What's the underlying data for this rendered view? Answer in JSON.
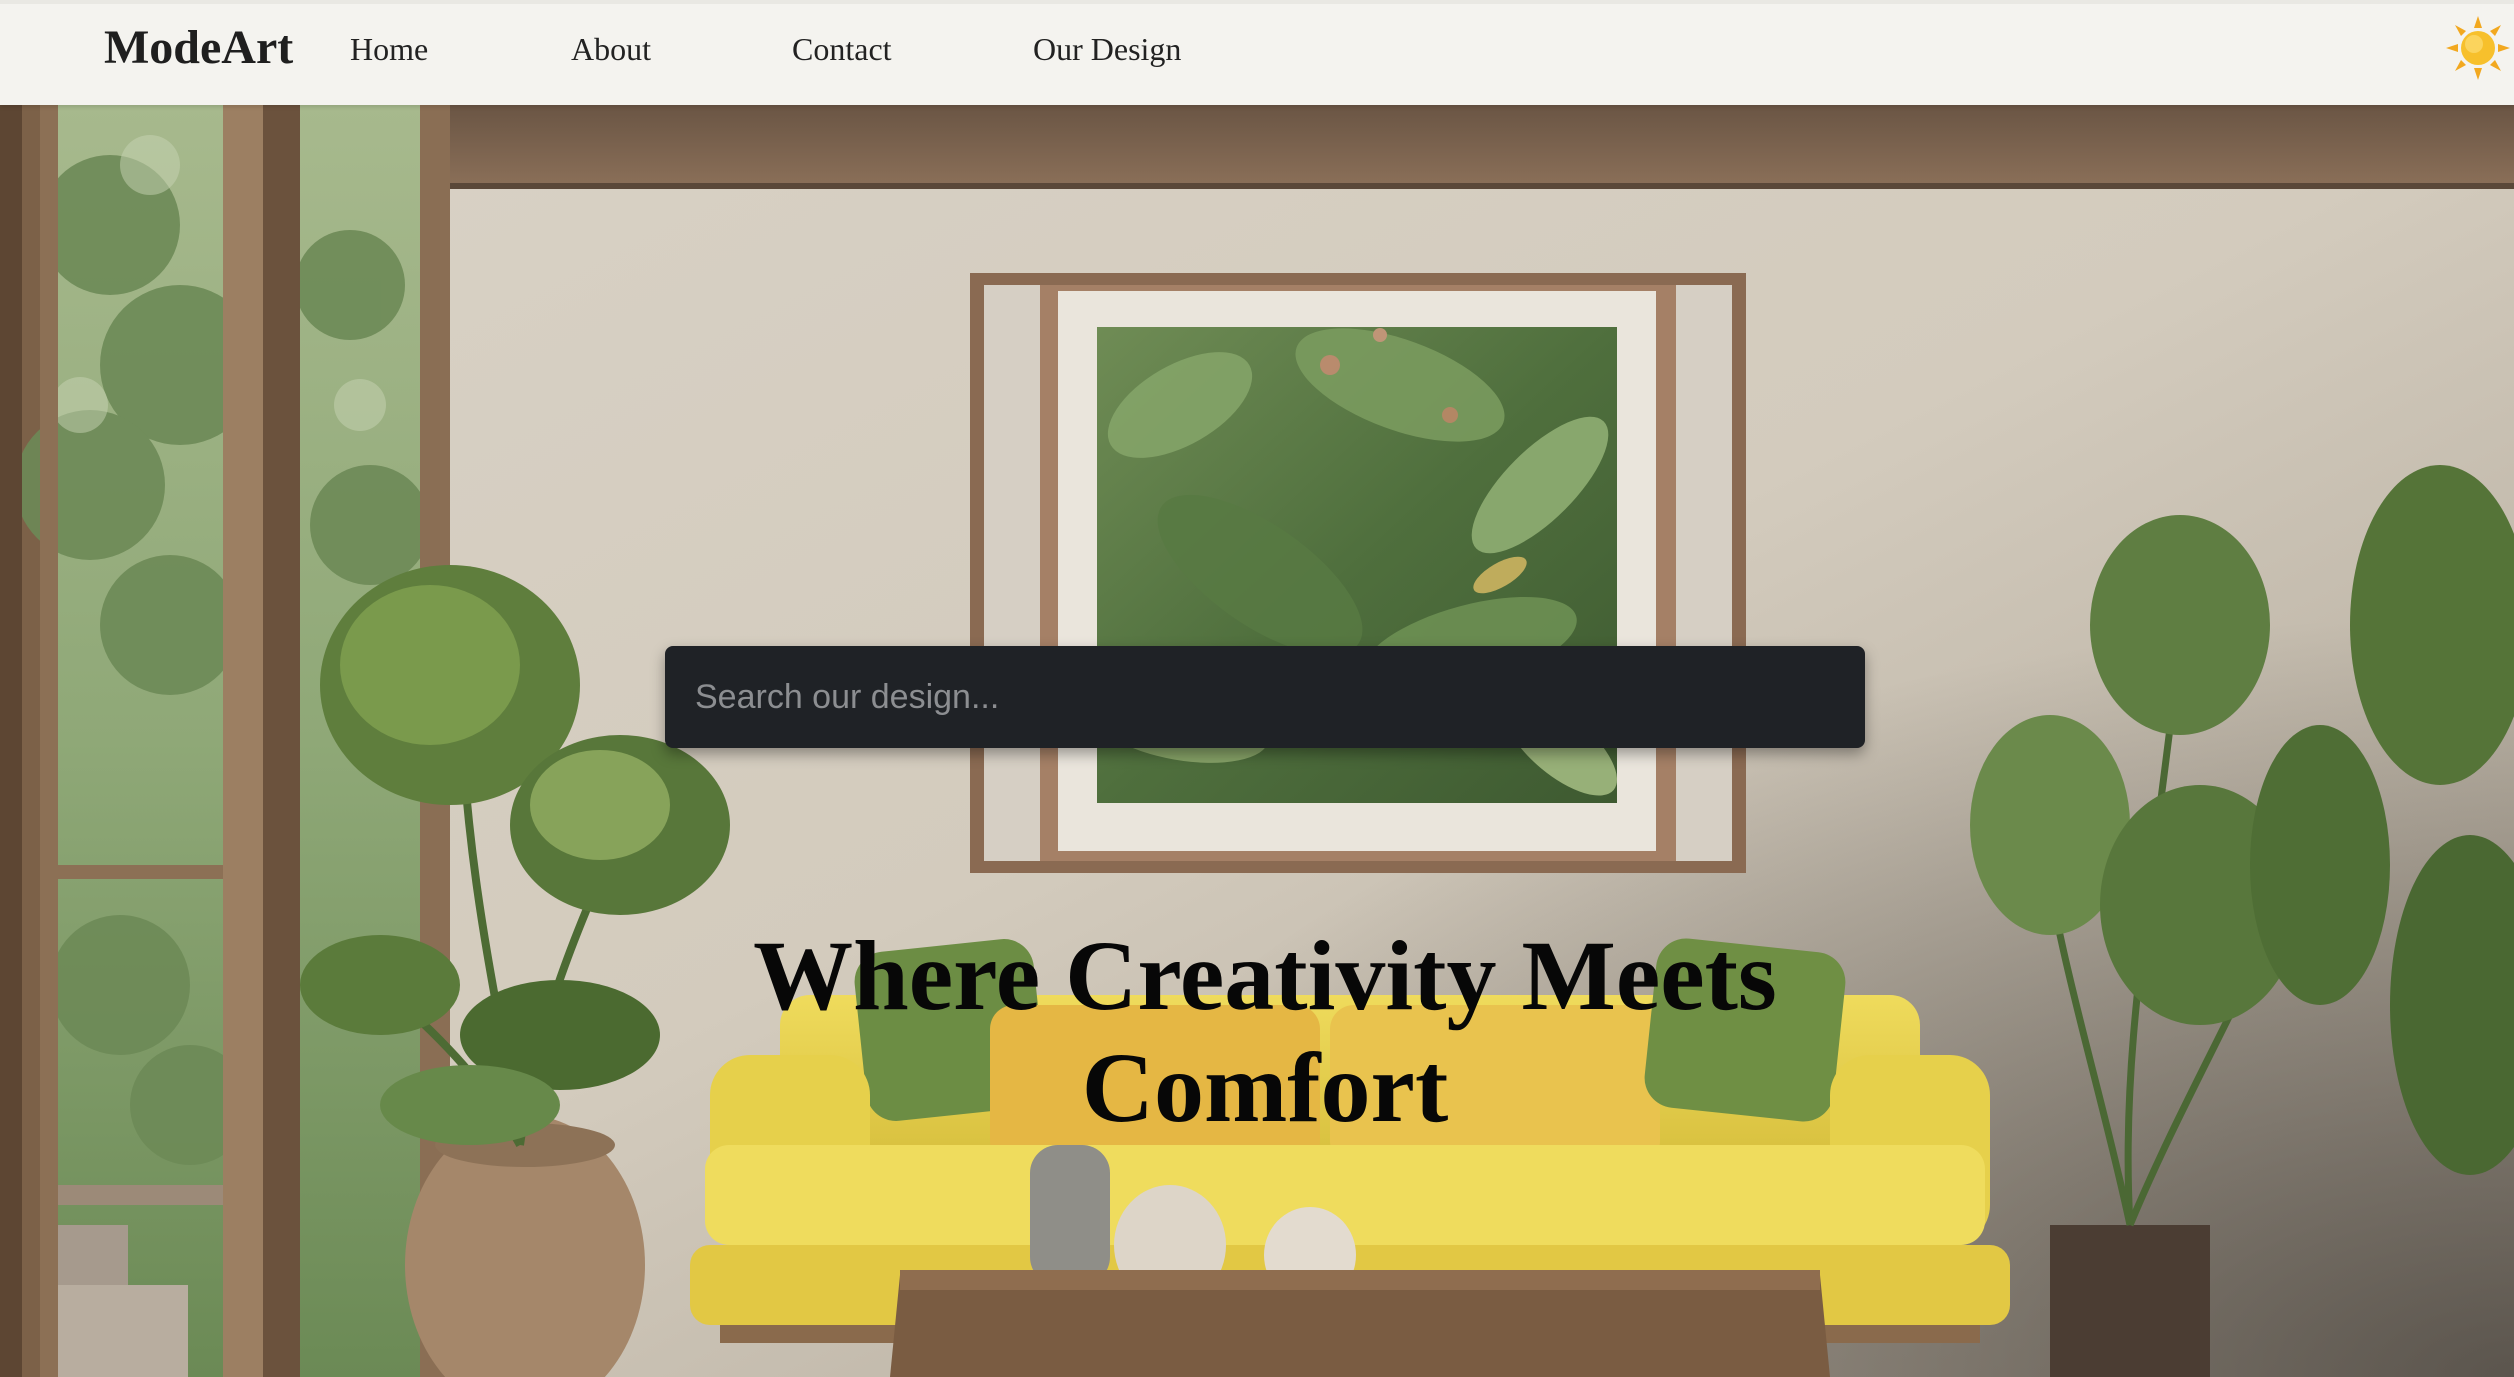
{
  "nav": {
    "brand": "ModeArt",
    "links": [
      {
        "label": "Home"
      },
      {
        "label": "About"
      },
      {
        "label": "Contact"
      },
      {
        "label": "Our Design"
      }
    ],
    "theme_icon": "sun-icon"
  },
  "search": {
    "placeholder": "Search our design..."
  },
  "hero": {
    "headline": "Where Creativity Meets Comfort",
    "background": "living-room-photo"
  },
  "colors": {
    "nav_bg": "#f4f3ef",
    "search_bg": "#1f2226",
    "sofa": "#e8d24c",
    "headline": "#070707"
  }
}
